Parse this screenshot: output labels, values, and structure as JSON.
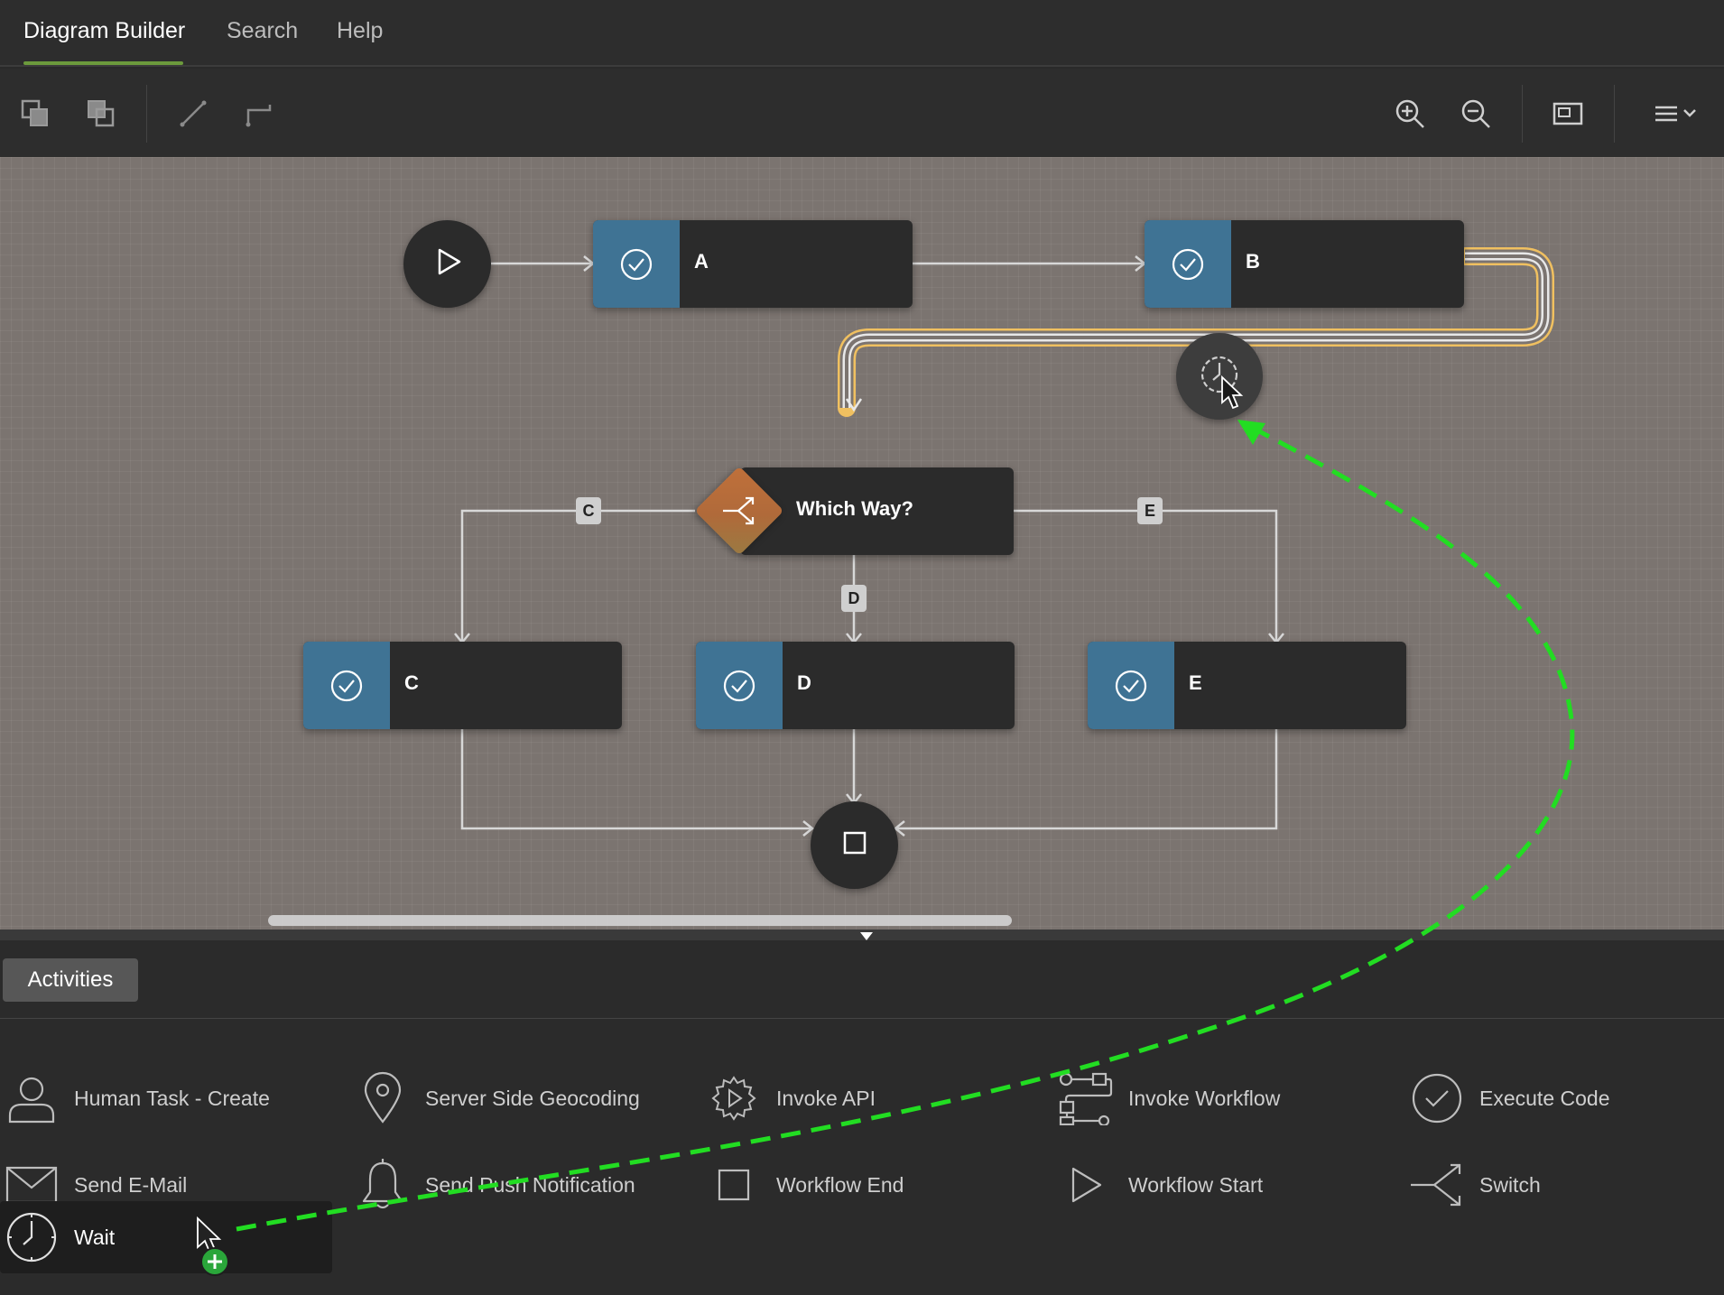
{
  "tabs": [
    {
      "label": "Diagram Builder",
      "active": true
    },
    {
      "label": "Search",
      "active": false
    },
    {
      "label": "Help",
      "active": false
    }
  ],
  "toolbar": {
    "left_icons": [
      "bring-forward-icon",
      "send-backward-icon",
      "straight-connector-icon",
      "elbow-connector-icon"
    ],
    "right_icons": [
      "zoom-in-icon",
      "zoom-out-icon",
      "fit-screen-icon",
      "menu-icon"
    ]
  },
  "diagram": {
    "start_icon": "play-icon",
    "end_icon": "stop-icon",
    "nodes": {
      "a": {
        "label": "A",
        "icon": "check-circle-icon"
      },
      "b": {
        "label": "B",
        "icon": "check-circle-icon"
      },
      "switch": {
        "label": "Which Way?",
        "icon": "switch-icon"
      },
      "c": {
        "label": "C",
        "icon": "check-circle-icon"
      },
      "d": {
        "label": "D",
        "icon": "check-circle-icon"
      },
      "e": {
        "label": "E",
        "icon": "check-circle-icon"
      }
    },
    "edge_labels": {
      "c": "C",
      "d": "D",
      "e": "E"
    },
    "drop_target_icon": "clock-icon",
    "colors": {
      "activity": "#3f7394",
      "switch": "#b8703d",
      "highlight": "#f0c060",
      "drag_path": "#22dd22"
    }
  },
  "palette": {
    "tab_label": "Activities",
    "items": [
      {
        "label": "Human Task - Create",
        "icon": "user-icon"
      },
      {
        "label": "Server Side Geocoding",
        "icon": "map-pin-icon"
      },
      {
        "label": "Invoke API",
        "icon": "gear-play-icon"
      },
      {
        "label": "Invoke Workflow",
        "icon": "workflow-icon"
      },
      {
        "label": "Execute Code",
        "icon": "check-circle-icon"
      },
      {
        "label": "Send E-Mail",
        "icon": "envelope-icon"
      },
      {
        "label": "Send Push Notification",
        "icon": "bell-icon"
      },
      {
        "label": "Workflow End",
        "icon": "square-icon"
      },
      {
        "label": "Workflow Start",
        "icon": "play-icon"
      },
      {
        "label": "Switch",
        "icon": "switch-icon"
      },
      {
        "label": "Wait",
        "icon": "clock-icon",
        "selected": true
      }
    ]
  }
}
